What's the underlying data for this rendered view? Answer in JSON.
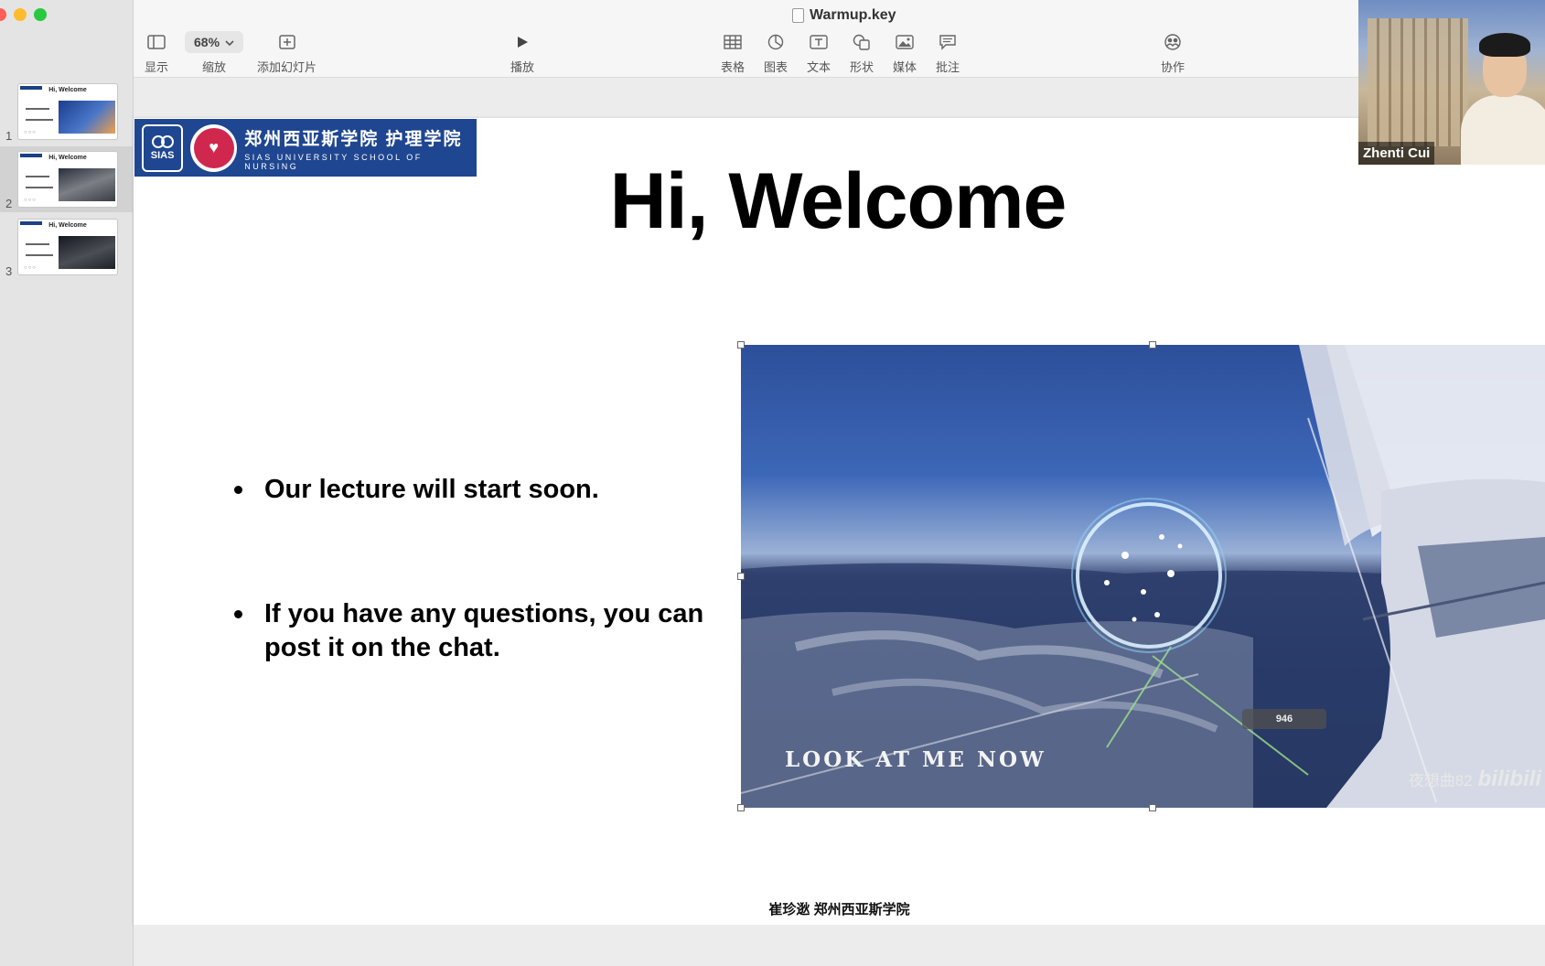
{
  "window": {
    "document_title": "Warmup.key",
    "traffic_lights": {
      "close": "#fe5f57",
      "minimize": "#febc2e",
      "zoom": "#28c840"
    }
  },
  "toolbar": {
    "view": {
      "label": "显示",
      "icon": "sidebar-icon"
    },
    "zoom": {
      "label": "缩放",
      "value": "68%",
      "icon": "chevron-down-icon"
    },
    "add_slide": {
      "label": "添加幻灯片",
      "icon": "plus-square-icon"
    },
    "play": {
      "label": "播放",
      "icon": "play-icon"
    },
    "table": {
      "label": "表格",
      "icon": "table-icon"
    },
    "chart": {
      "label": "图表",
      "icon": "chart-icon"
    },
    "text": {
      "label": "文本",
      "icon": "text-box-icon"
    },
    "shape": {
      "label": "形状",
      "icon": "shape-icon"
    },
    "media": {
      "label": "媒体",
      "icon": "image-icon"
    },
    "comment": {
      "label": "批注",
      "icon": "comment-icon"
    },
    "collaborate": {
      "label": "协作",
      "icon": "collaborate-icon"
    }
  },
  "sidebar": {
    "slides": [
      {
        "number": "1",
        "title": "Hi, Welcome",
        "selected": false
      },
      {
        "number": "2",
        "title": "Hi, Welcome",
        "selected": true
      },
      {
        "number": "3",
        "title": "Hi, Welcome",
        "selected": false
      }
    ]
  },
  "slide": {
    "banner": {
      "logo_text": "SIAS",
      "cn": "郑州西亚斯学院 护理学院",
      "en": "SIAS UNIVERSITY SCHOOL OF NURSING"
    },
    "title": "Hi, Welcome",
    "bullets": [
      "Our lecture will start soon.",
      "If you have any questions, you can post it on the chat."
    ],
    "video": {
      "caption": "LOOK AT ME NOW",
      "watermark": "夜想曲82",
      "watermark_brand": "bilibili",
      "counter": "946"
    },
    "footer": "崔珍逖 郑州西亚斯学院"
  },
  "webcam": {
    "participant_name": "Zhenti Cui"
  }
}
